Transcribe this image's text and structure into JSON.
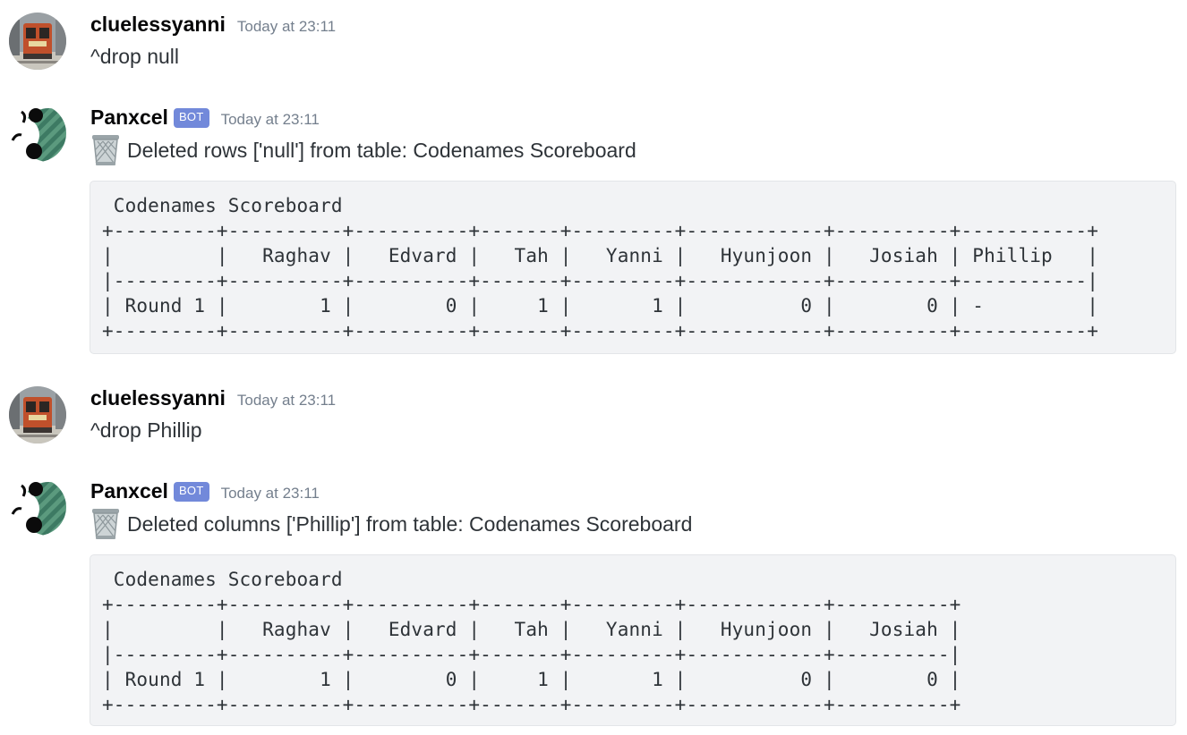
{
  "messages": [
    {
      "username": "cluelessyanni",
      "timestamp": "Today at 23:11",
      "text": "^drop null",
      "avatar_icon": "train-icon"
    },
    {
      "username": "Panxcel",
      "bot_tag": "BOT",
      "timestamp": "Today at 23:11",
      "text": "Deleted rows ['null'] from table: Codenames Scoreboard",
      "emoji_icon": "wastebasket-icon",
      "avatar_icon": "panda-icon",
      "code": " Codenames Scoreboard\n+---------+----------+----------+-------+---------+------------+----------+-----------+\n|         |   Raghav |   Edvard |   Tah |   Yanni |   Hyunjoon |   Josiah | Phillip   |\n|---------+----------+----------+-------+---------+------------+----------+-----------|\n| Round 1 |        1 |        0 |     1 |       1 |          0 |        0 | -         |\n+---------+----------+----------+-------+---------+------------+----------+-----------+"
    },
    {
      "username": "cluelessyanni",
      "timestamp": "Today at 23:11",
      "text": "^drop Phillip",
      "avatar_icon": "train-icon"
    },
    {
      "username": "Panxcel",
      "bot_tag": "BOT",
      "timestamp": "Today at 23:11",
      "text": "Deleted columns ['Phillip'] from table: Codenames Scoreboard",
      "emoji_icon": "wastebasket-icon",
      "avatar_icon": "panda-icon",
      "code": " Codenames Scoreboard\n+---------+----------+----------+-------+---------+------------+----------+\n|         |   Raghav |   Edvard |   Tah |   Yanni |   Hyunjoon |   Josiah |\n|---------+----------+----------+-------+---------+------------+----------|\n| Round 1 |        1 |        0 |     1 |       1 |          0 |        0 |\n+---------+----------+----------+-------+---------+------------+----------+"
    }
  ]
}
